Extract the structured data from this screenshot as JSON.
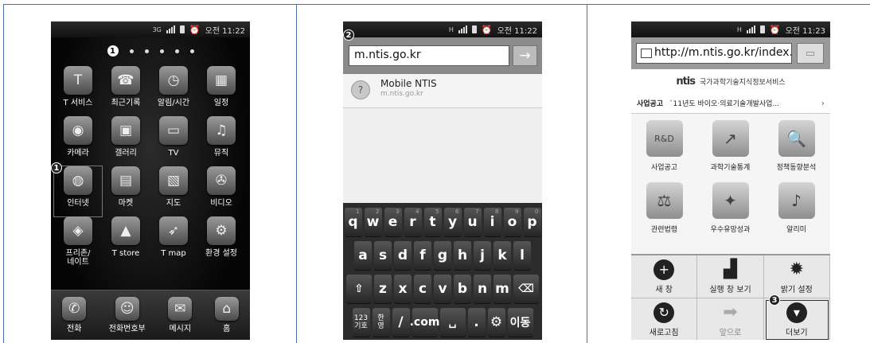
{
  "panels": {
    "home": {
      "status": {
        "signal_label": "3G",
        "time": "오전 11:22"
      },
      "page_indicator": "1",
      "apps": [
        {
          "label": "T 서비스",
          "icon": "t-service-icon",
          "glyph": "T"
        },
        {
          "label": "최근기록",
          "icon": "phone-log-icon",
          "glyph": "☎"
        },
        {
          "label": "알림/시간",
          "icon": "clock-icon",
          "glyph": "◷"
        },
        {
          "label": "일정",
          "icon": "calendar-icon",
          "glyph": "▦"
        },
        {
          "label": "카메라",
          "icon": "camera-icon",
          "glyph": "◉"
        },
        {
          "label": "갤러리",
          "icon": "gallery-icon",
          "glyph": "▣"
        },
        {
          "label": "TV",
          "icon": "tv-icon",
          "glyph": "▭"
        },
        {
          "label": "뮤직",
          "icon": "music-icon",
          "glyph": "♫"
        },
        {
          "label": "인터넷",
          "icon": "globe-icon",
          "glyph": "◍"
        },
        {
          "label": "마켓",
          "icon": "market-bag-icon",
          "glyph": "▤"
        },
        {
          "label": "지도",
          "icon": "map-icon",
          "glyph": "▧"
        },
        {
          "label": "비디오",
          "icon": "video-reel-icon",
          "glyph": "✇"
        },
        {
          "label": "프리존/\n네이트",
          "icon": "freezone-icon",
          "glyph": "◈"
        },
        {
          "label": "T store",
          "icon": "tstore-icon",
          "glyph": "▲"
        },
        {
          "label": "T map",
          "icon": "tmap-icon",
          "glyph": "➶"
        },
        {
          "label": "환경 설정",
          "icon": "settings-gear-icon",
          "glyph": "⚙"
        }
      ],
      "dock": [
        {
          "label": "전화",
          "icon": "phone-icon",
          "glyph": "✆"
        },
        {
          "label": "전화번호부",
          "icon": "contacts-icon",
          "glyph": "☺"
        },
        {
          "label": "메시지",
          "icon": "message-envelope-icon",
          "glyph": "✉"
        },
        {
          "label": "홈",
          "icon": "home-icon",
          "glyph": "⌂"
        }
      ],
      "callout": "1"
    },
    "address": {
      "status": {
        "signal_label": "H",
        "time": "오전 11:22"
      },
      "callout": "2",
      "url_value": "m.ntis.go.kr",
      "go_label": "→",
      "suggestion": {
        "title": "Mobile NTIS",
        "url": "m.ntis.go.kr"
      },
      "keyboard": {
        "row1": [
          {
            "k": "q",
            "n": "1"
          },
          {
            "k": "w",
            "n": "2"
          },
          {
            "k": "e",
            "n": "3"
          },
          {
            "k": "r",
            "n": "4"
          },
          {
            "k": "t",
            "n": "5"
          },
          {
            "k": "y",
            "n": "6"
          },
          {
            "k": "u",
            "n": "7"
          },
          {
            "k": "i",
            "n": "8"
          },
          {
            "k": "o",
            "n": "9"
          },
          {
            "k": "p",
            "n": "0"
          }
        ],
        "row2": [
          "a",
          "s",
          "d",
          "f",
          "g",
          "h",
          "j",
          "k",
          "l"
        ],
        "row3": [
          "⇧",
          "z",
          "x",
          "c",
          "v",
          "b",
          "n",
          "m",
          "⌫"
        ],
        "row4": [
          "123\n기호",
          "한\n영",
          "/",
          ".com",
          "␣",
          ".",
          "⚙",
          "이동"
        ]
      }
    },
    "browser": {
      "status": {
        "signal_label": "H",
        "time": "오전 11:23"
      },
      "url": "http://m.ntis.go.kr/index...",
      "site_logo": "ntis",
      "site_name": "국가과학기술지식정보서비스",
      "ticker_label": "사업공고",
      "ticker_text": "`11년도 바이오·의료기술개발사업...",
      "ticker_more": "›",
      "tiles": [
        {
          "label": "사업공고",
          "icon": "new-rnd-icon",
          "glyph": "R&D"
        },
        {
          "label": "과학기술통계",
          "icon": "statistics-chart-icon",
          "glyph": "↗"
        },
        {
          "label": "정책동향분석",
          "icon": "policy-analysis-icon",
          "glyph": "🔍"
        },
        {
          "label": "관련법령",
          "icon": "law-book-icon",
          "glyph": "⚖"
        },
        {
          "label": "우수유망성과",
          "icon": "lightbulb-icon",
          "glyph": "✦"
        },
        {
          "label": "알리미",
          "icon": "notifier-icon",
          "glyph": "♪"
        }
      ],
      "menu": [
        {
          "label": "새 창",
          "icon": "new-window-plus-icon",
          "glyph": "+",
          "style": "mic"
        },
        {
          "label": "실행 창 보기",
          "icon": "windows-stack-icon",
          "glyph": "▟",
          "style": "mic plain"
        },
        {
          "label": "밝기 설정",
          "icon": "brightness-sun-icon",
          "glyph": "✹",
          "style": "mic plain"
        },
        {
          "label": "새로고침",
          "icon": "refresh-icon",
          "glyph": "↻",
          "style": "mic"
        },
        {
          "label": "앞으로",
          "icon": "forward-arrow-icon",
          "glyph": "➡",
          "style": "mic dis",
          "disabled": true
        },
        {
          "label": "더보기",
          "icon": "more-chevron-down-icon",
          "glyph": "▾",
          "style": "mic"
        }
      ],
      "callout": "3"
    }
  }
}
